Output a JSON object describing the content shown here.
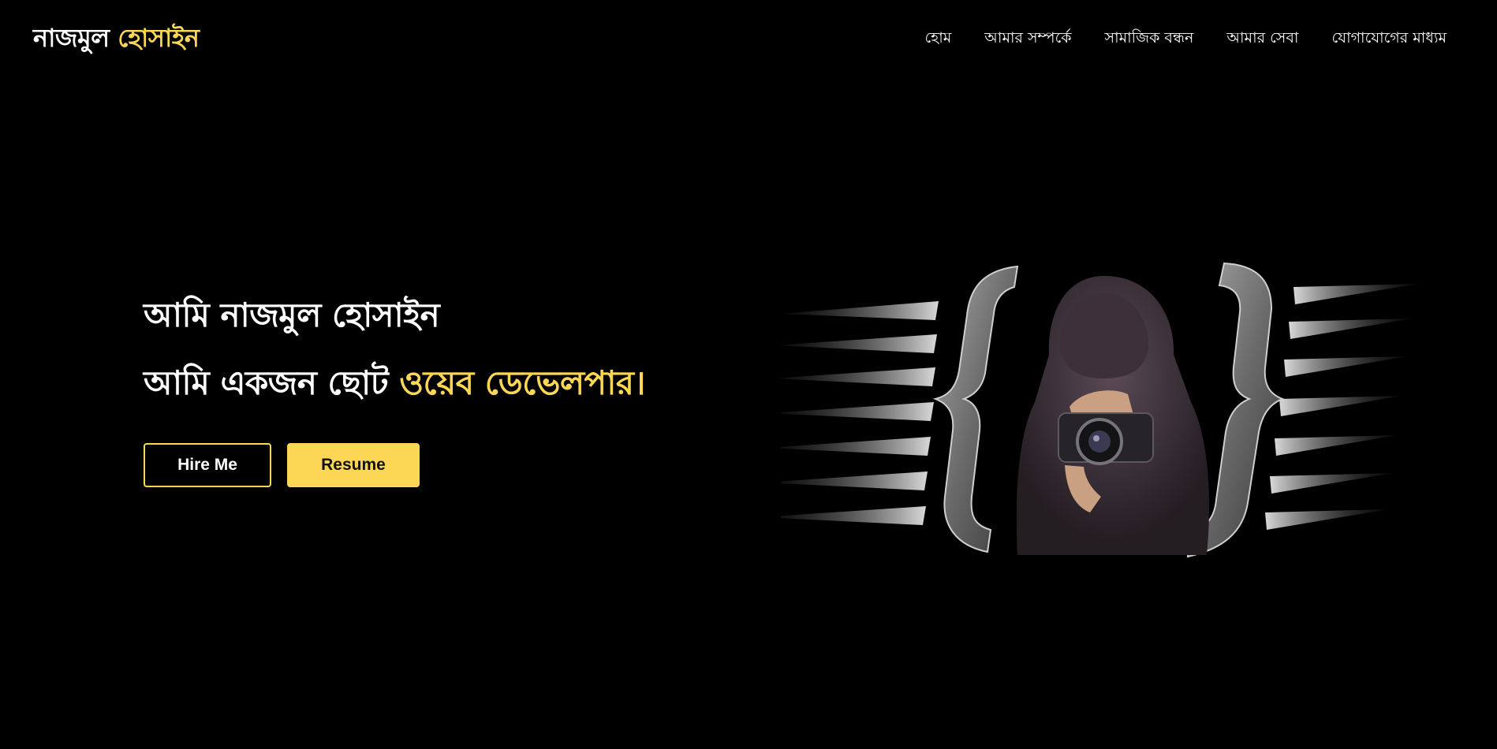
{
  "brand": {
    "first": "নাজমুল",
    "second": "হোসাইন",
    "accent_color": "#fcd755"
  },
  "nav": {
    "items": [
      {
        "label": "হোম"
      },
      {
        "label": "আমার সম্পর্কে"
      },
      {
        "label": "সামাজিক বন্ধন"
      },
      {
        "label": "আমার সেবা"
      },
      {
        "label": "যোগাযোগের মাধ্যম"
      }
    ]
  },
  "hero": {
    "line1": "আমি নাজমুল হোসাইন",
    "line2_prefix": "আমি একজন ছোট",
    "line2_accent": "ওয়েব ডেভেলপার।"
  },
  "buttons": {
    "hire_label": "Hire Me",
    "resume_label": "Resume"
  },
  "illustration": {
    "icon": "hooded-photographer-in-braces-icon"
  }
}
